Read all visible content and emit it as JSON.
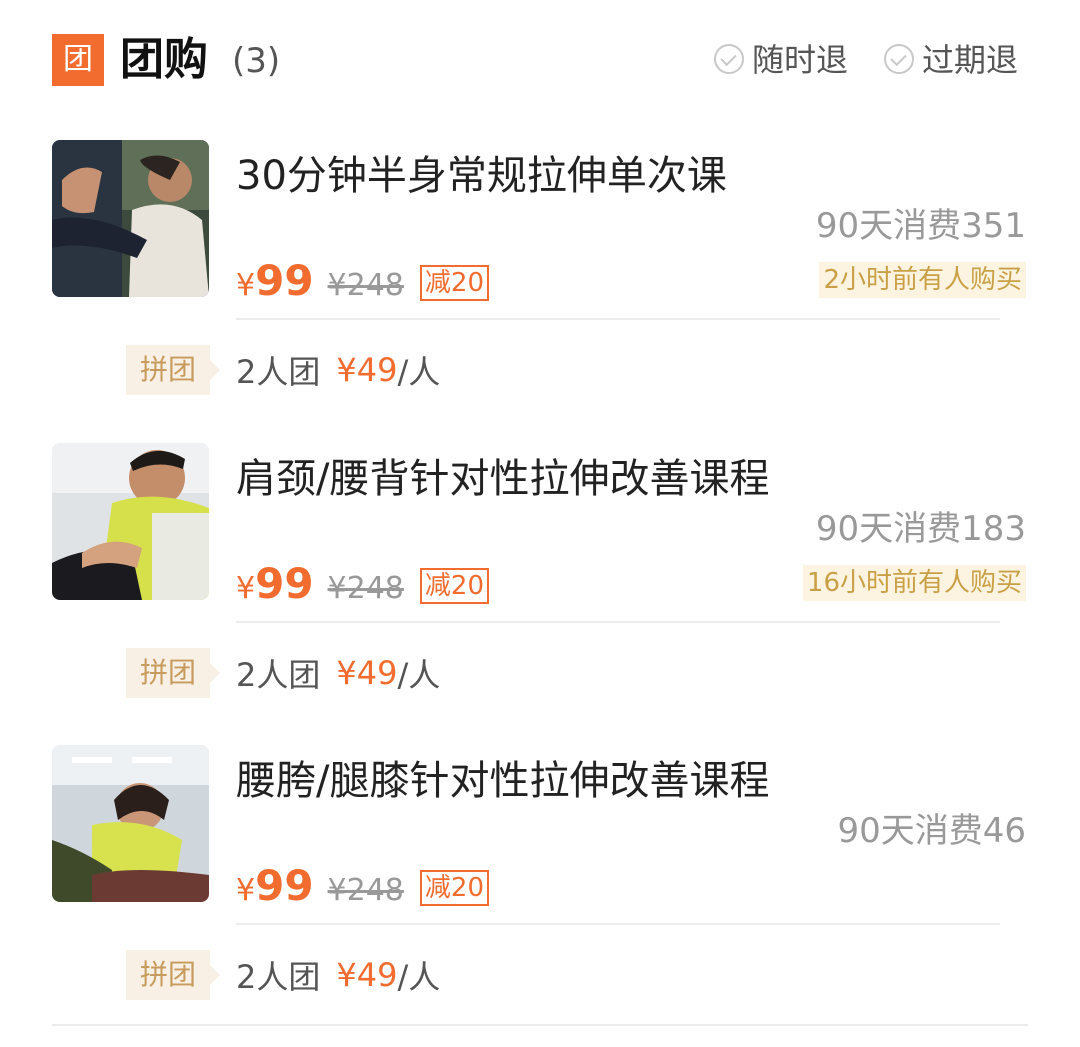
{
  "header": {
    "badge": "团",
    "title": "团购",
    "count": "(3)",
    "policies": [
      "随时退",
      "过期退"
    ]
  },
  "deals": [
    {
      "title": "30分钟半身常规拉伸单次课",
      "sales": "90天消费351",
      "currency": "¥",
      "price": "99",
      "original_price": "¥248",
      "discount": "减20",
      "recent": "2小时前有人购买",
      "group": {
        "tag": "拼团",
        "size": "2人团",
        "price": "¥49",
        "unit": "/人"
      }
    },
    {
      "title": "肩颈/腰背针对性拉伸改善课程",
      "sales": "90天消费183",
      "currency": "¥",
      "price": "99",
      "original_price": "¥248",
      "discount": "减20",
      "recent": "16小时前有人购买",
      "group": {
        "tag": "拼团",
        "size": "2人团",
        "price": "¥49",
        "unit": "/人"
      }
    },
    {
      "title": "腰胯/腿膝针对性拉伸改善课程",
      "sales": "90天消费46",
      "currency": "¥",
      "price": "99",
      "original_price": "¥248",
      "discount": "减20",
      "group": {
        "tag": "拼团",
        "size": "2人团",
        "price": "¥49",
        "unit": "/人"
      }
    }
  ],
  "colors": {
    "accent": "#f26c2f",
    "muted": "#999999",
    "recent_bg": "#fcf4e0",
    "recent_text": "#c9a047",
    "group_tag_bg": "#f8f0e4",
    "group_tag_text": "#c79b5d"
  }
}
